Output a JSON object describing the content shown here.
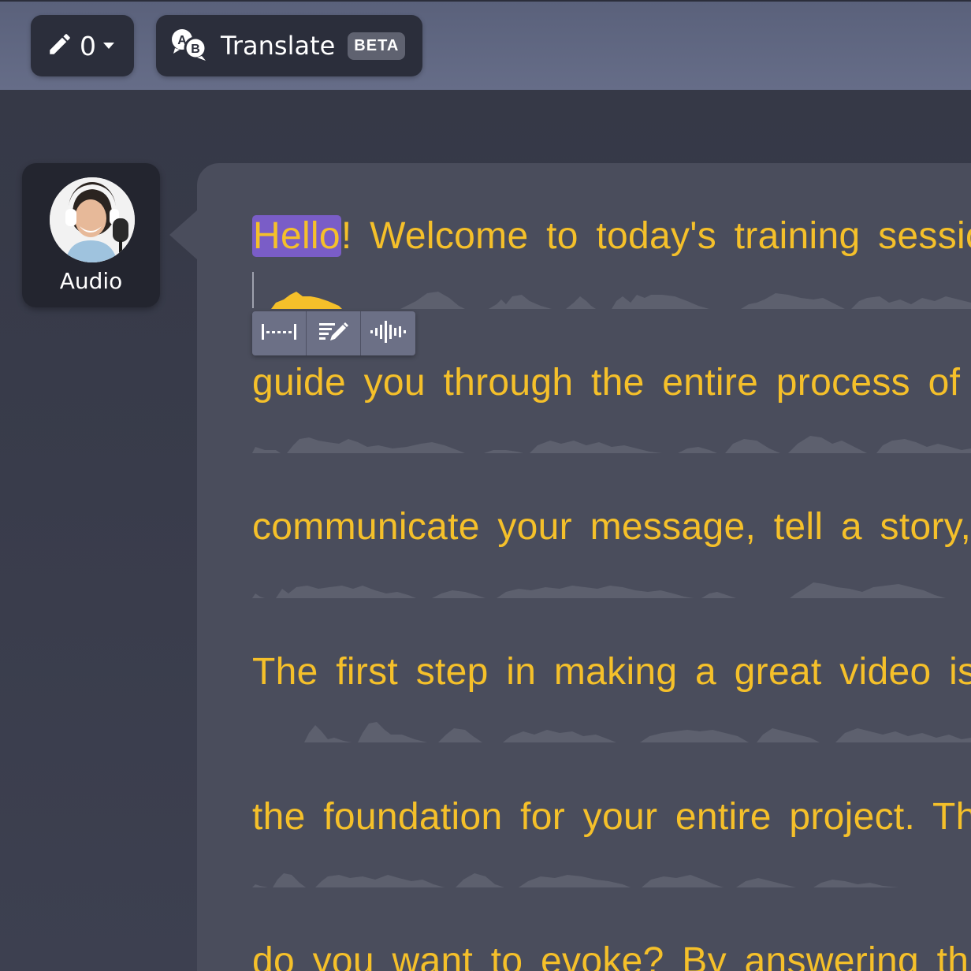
{
  "toolbar": {
    "edit_count": "0",
    "translate_label": "Translate",
    "beta_badge": "BETA"
  },
  "speaker": {
    "name": "Audio"
  },
  "transcript": {
    "lines": [
      {
        "highlight": "Hello",
        "rest": "! Welcome to today's training sessio"
      },
      {
        "text": "guide you through the entire process of"
      },
      {
        "text": "communicate your message, tell a story,"
      },
      {
        "text": "The first step in making a great video is"
      },
      {
        "text": "the foundation for your entire project. Th"
      },
      {
        "text": "do you want to evoke? By answering th"
      }
    ]
  },
  "mini_toolbar": {
    "items": [
      {
        "icon": "gap-icon"
      },
      {
        "icon": "edit-text-icon"
      },
      {
        "icon": "waveform-icon"
      }
    ]
  },
  "colors": {
    "transcript_text": "#f5c02a",
    "word_highlight": "#7a5dc7",
    "waveform": "#5d606e",
    "active_waveform": "#f5c02a"
  }
}
